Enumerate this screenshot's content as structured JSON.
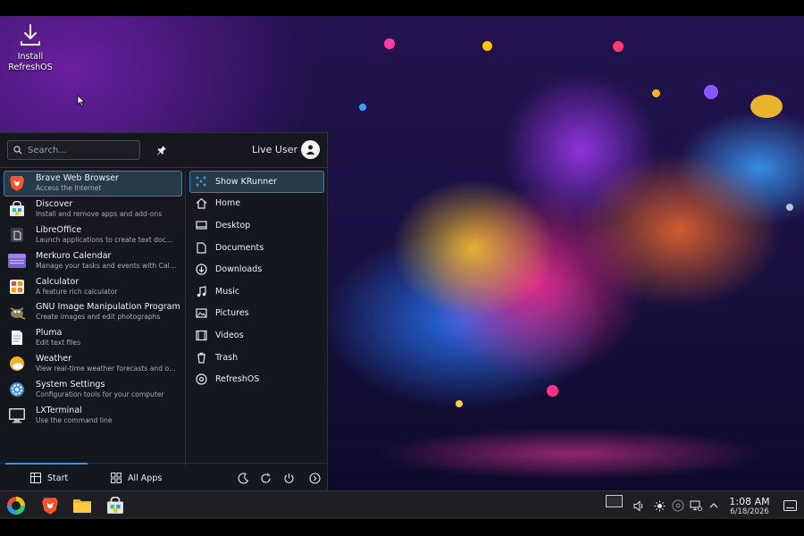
{
  "desktop": {
    "install_icon_label": "Install RefreshOS"
  },
  "launcher": {
    "search_placeholder": "Search...",
    "user_name": "Live User",
    "favorites": [
      {
        "name": "Brave Web Browser",
        "desc": "Access the Internet",
        "icon": "brave-icon",
        "selected": true
      },
      {
        "name": "Discover",
        "desc": "Install and remove apps and add-ons",
        "icon": "discover-icon",
        "selected": false
      },
      {
        "name": "LibreOffice",
        "desc": "Launch applications to create text docum...",
        "icon": "libreoffice-icon",
        "selected": false
      },
      {
        "name": "Merkuro Calendar",
        "desc": "Manage your tasks and events with Calen...",
        "icon": "calendar-icon",
        "selected": false
      },
      {
        "name": "Calculator",
        "desc": "A feature rich calculator",
        "icon": "calculator-icon",
        "selected": false
      },
      {
        "name": "GNU Image Manipulation Program",
        "desc": "Create images and edit photographs",
        "icon": "gimp-icon",
        "selected": false
      },
      {
        "name": "Pluma",
        "desc": "Edit text files",
        "icon": "text-editor-icon",
        "selected": false
      },
      {
        "name": "Weather",
        "desc": "View real-time weather forecasts and oth...",
        "icon": "weather-icon",
        "selected": false
      },
      {
        "name": "System Settings",
        "desc": "Configuration tools for your computer",
        "icon": "settings-icon",
        "selected": false
      },
      {
        "name": "LXTerminal",
        "desc": "Use the command line",
        "icon": "terminal-icon",
        "selected": false
      }
    ],
    "places": [
      {
        "label": "Show KRunner",
        "icon": "krunner-icon",
        "selected": true
      },
      {
        "label": "Home",
        "icon": "home-icon",
        "selected": false
      },
      {
        "label": "Desktop",
        "icon": "desktop-icon",
        "selected": false
      },
      {
        "label": "Documents",
        "icon": "documents-icon",
        "selected": false
      },
      {
        "label": "Downloads",
        "icon": "downloads-icon",
        "selected": false
      },
      {
        "label": "Music",
        "icon": "music-icon",
        "selected": false
      },
      {
        "label": "Pictures",
        "icon": "pictures-icon",
        "selected": false
      },
      {
        "label": "Videos",
        "icon": "videos-icon",
        "selected": false
      },
      {
        "label": "Trash",
        "icon": "trash-icon",
        "selected": false
      },
      {
        "label": "RefreshOS",
        "icon": "refreshos-icon",
        "selected": false
      }
    ],
    "footer": {
      "start_label": "Start",
      "all_apps_label": "All Apps"
    }
  },
  "taskbar": {
    "clock_time": "1:08 AM",
    "clock_date": "6/18/2026"
  },
  "colors": {
    "accent": "#3e8fd6",
    "selection_bg": "#263a4a",
    "selection_border": "#3f7fae",
    "panel_bg": "#16181e",
    "taskbar_bg": "#1d1f24"
  }
}
